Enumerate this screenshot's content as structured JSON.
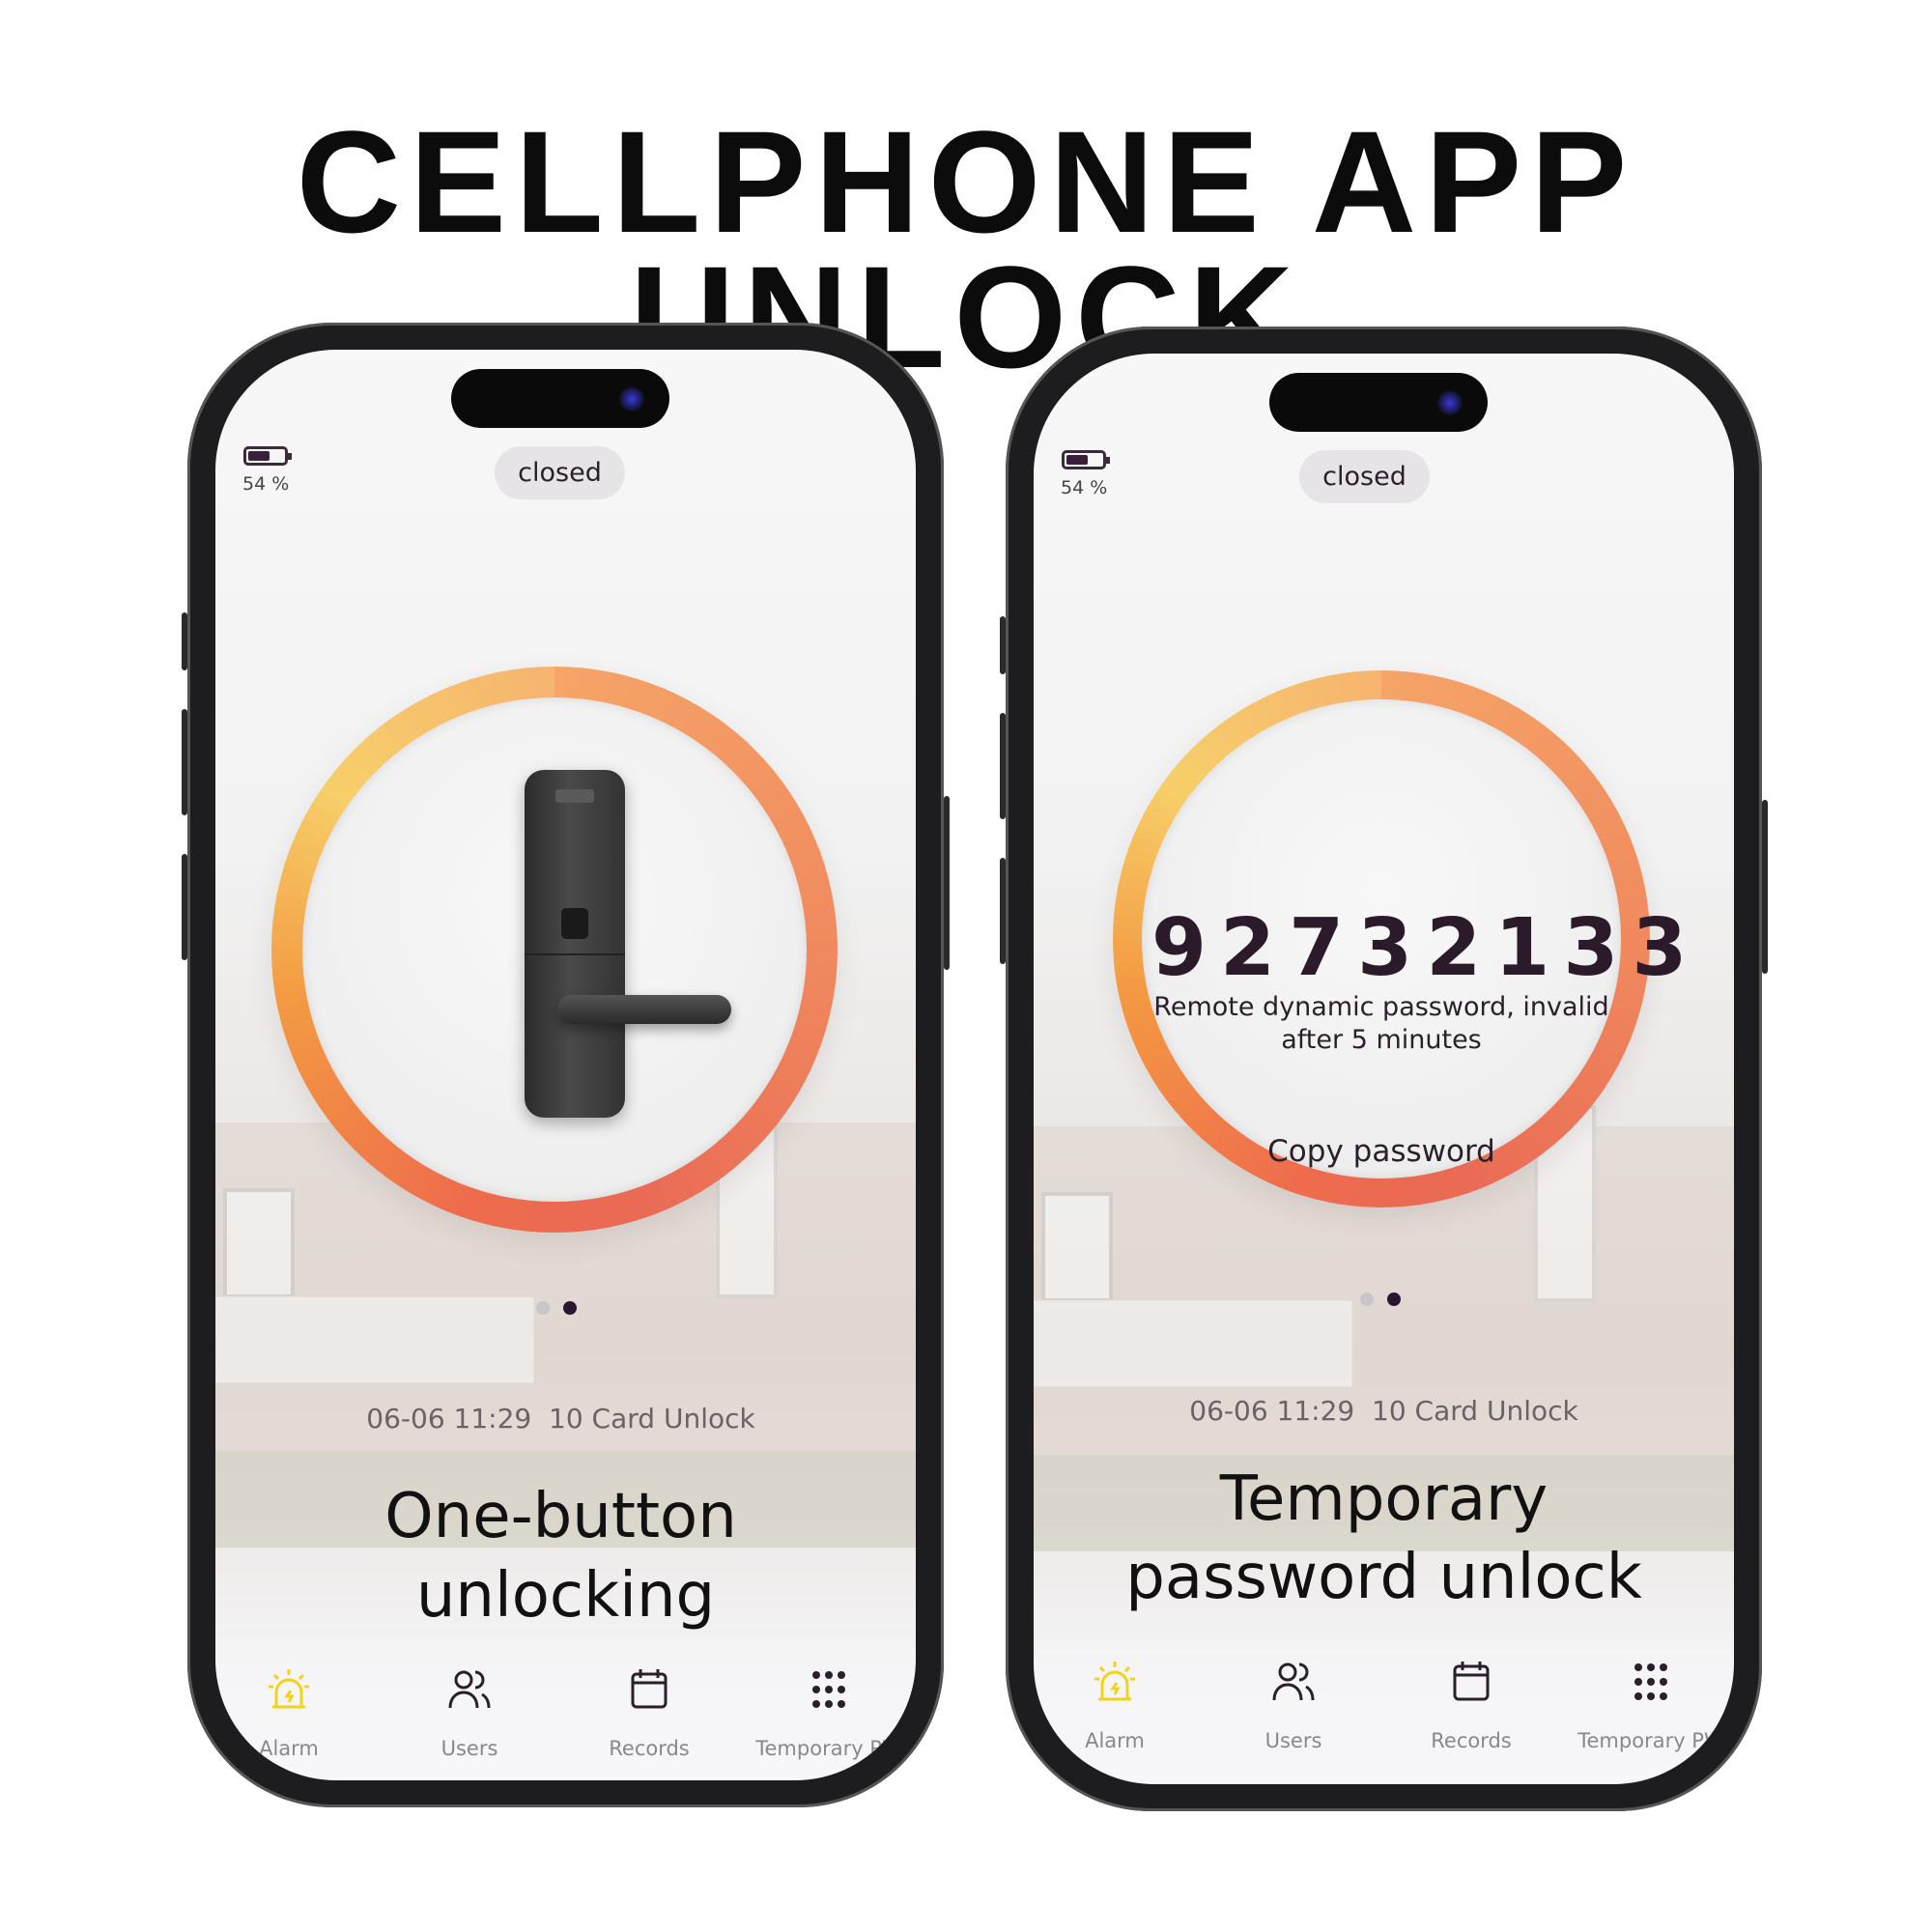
{
  "title": "CELLPHONE APP UNLOCK",
  "colors": {
    "accent_yellow": "#f2d21c",
    "ring_orange": "#f08a5e",
    "ring_yellow": "#f7cf6a",
    "text_dark": "#2a1f2a"
  },
  "phones": [
    {
      "battery_percent": "54 %",
      "battery_level": 0.54,
      "lock_status": "closed",
      "center_icon": "door-lock-icon",
      "carousel": {
        "total": 2,
        "active": 2
      },
      "last_record": "06-06 11:29  10 Card Unlock",
      "caption_line1": "One-button",
      "caption_line2": "unlocking",
      "tabs": [
        {
          "label": "Alarm",
          "icon": "alarm-icon",
          "active": true
        },
        {
          "label": "Users",
          "icon": "users-icon"
        },
        {
          "label": "Records",
          "icon": "calendar-icon"
        },
        {
          "label": "Temporary PW",
          "icon": "keypad-icon"
        }
      ]
    },
    {
      "battery_percent": "54 %",
      "battery_level": 0.54,
      "lock_status": "closed",
      "password": "92732133",
      "password_note_line1": "Remote dynamic password, invalid",
      "password_note_line2": "after 5 minutes",
      "copy_label": "Copy password",
      "carousel": {
        "total": 2,
        "active": 2
      },
      "last_record": "06-06 11:29  10 Card Unlock",
      "caption_line1": "Temporary",
      "caption_line2": "password unlock",
      "tabs": [
        {
          "label": "Alarm",
          "icon": "alarm-icon",
          "active": true
        },
        {
          "label": "Users",
          "icon": "users-icon"
        },
        {
          "label": "Records",
          "icon": "calendar-icon"
        },
        {
          "label": "Temporary PW",
          "icon": "keypad-icon"
        }
      ]
    }
  ]
}
